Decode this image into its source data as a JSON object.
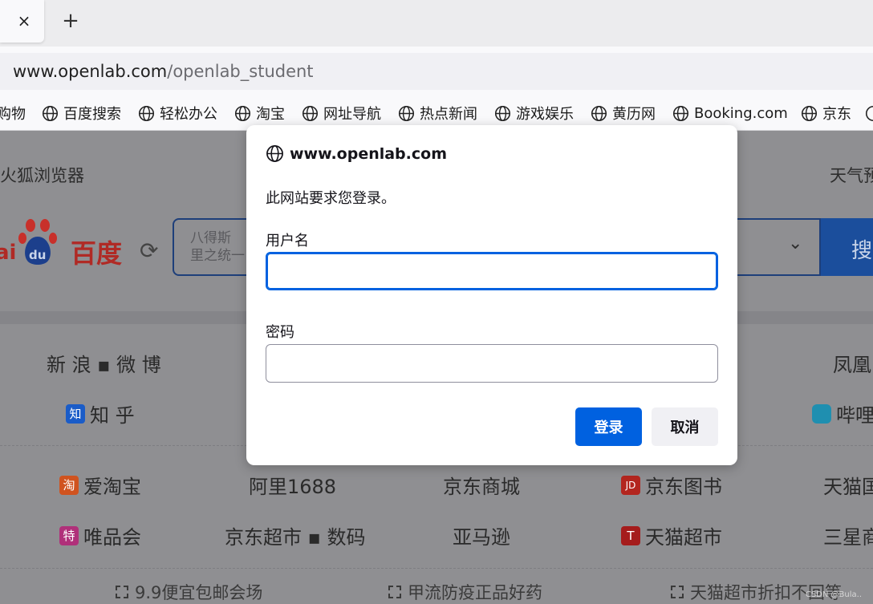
{
  "tab": {
    "close_label": "×"
  },
  "newtab_label": "+",
  "urlbar": {
    "host": "www.openlab.com",
    "path": "/openlab_student"
  },
  "bookmarks": [
    {
      "label": "购物",
      "icon": "none"
    },
    {
      "label": "百度搜索",
      "icon": "globe-icon"
    },
    {
      "label": "轻松办公",
      "icon": "globe-icon"
    },
    {
      "label": "淘宝",
      "icon": "globe-icon"
    },
    {
      "label": "网址导航",
      "icon": "globe-icon"
    },
    {
      "label": "热点新闻",
      "icon": "globe-icon"
    },
    {
      "label": "游戏娱乐",
      "icon": "globe-icon"
    },
    {
      "label": "黄历网",
      "icon": "globe-icon"
    },
    {
      "label": "Booking.com",
      "icon": "globe-icon"
    },
    {
      "label": "京东",
      "icon": "globe-icon"
    }
  ],
  "page": {
    "browser_name": "火狐浏览器",
    "weather": "天气预",
    "logo_text": "百度",
    "logo_du": "du",
    "logo_ai": "ai",
    "search_hint_1": "八得斯",
    "search_hint_2": "里之统一",
    "search_button": "搜",
    "sites": {
      "sina": "新 浪 ▪ 微 博",
      "fenghuang": "凤凰",
      "zhihu": "知 乎",
      "zhihu_badge": "知",
      "bilibili": "哔哩",
      "aitaobao": "爱淘宝",
      "aitaobao_badge": "淘",
      "ali1688": "阿里1688",
      "jd_mall": "京东商城",
      "jd_books": "京东图书",
      "jd_badge": "JD",
      "tmall_intl": "天猫国",
      "vip": "唯品会",
      "vip_badge": "特",
      "jd_super": "京东超市 ▪ 数码",
      "amazon": "亚马逊",
      "tmall_super": "天猫超市",
      "tmall_badge": "T",
      "sanxing": "三星商"
    },
    "promos": [
      "9.9便宜包邮会场",
      "甲流防疫正品好药",
      "天猫超市折扣不回等"
    ],
    "watermark": "CSDN @Bula.."
  },
  "dialog": {
    "title": "www.openlab.com",
    "message": "此网站要求您登录。",
    "username_label": "用户名",
    "username_value": "",
    "password_label": "密码",
    "password_value": "",
    "login_button": "登录",
    "cancel_button": "取消",
    "accent_color": "#0061e0"
  }
}
